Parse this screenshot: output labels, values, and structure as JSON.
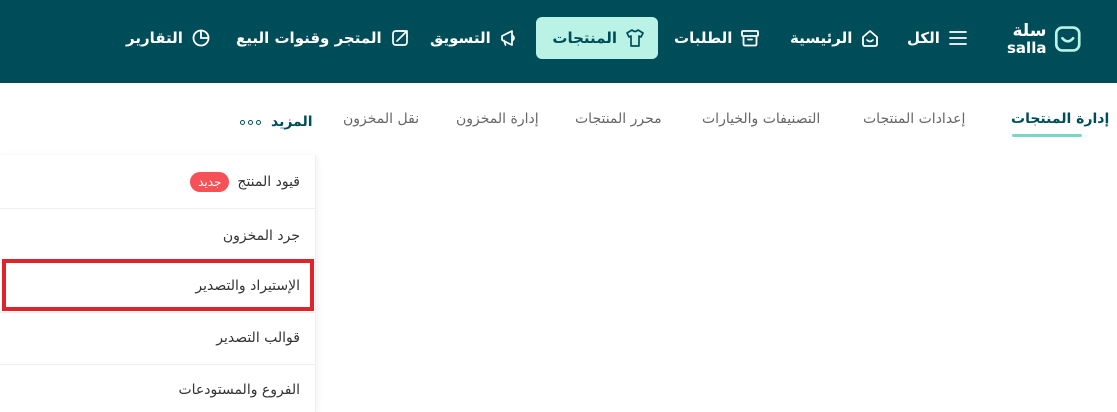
{
  "brand": {
    "name_ar": "سلة",
    "name_en": "salla",
    "colors": {
      "topbar": "#004d5a",
      "active_nav": "#baf3e6",
      "accent": "#7ad7c8",
      "badge": "#f55157",
      "highlight": "#e0242b"
    }
  },
  "nav": {
    "all": {
      "label": "الكل",
      "icon": "menu-icon"
    },
    "home": {
      "label": "الرئيسية",
      "icon": "home-icon"
    },
    "orders": {
      "label": "الطلبات",
      "icon": "archive-box-icon"
    },
    "products": {
      "label": "المنتجات",
      "icon": "tshirt-icon"
    },
    "marketing": {
      "label": "التسويق",
      "icon": "megaphone-icon"
    },
    "store": {
      "label": "المتجر وقنوات البيع",
      "icon": "store-channels-icon"
    },
    "reports": {
      "label": "التقارير",
      "icon": "pie-chart-icon"
    }
  },
  "tabs": {
    "product_management": "إدارة المنتجات",
    "product_settings": "إعدادات المنتجات",
    "categories_options": "التصنيفات والخيارات",
    "product_editor": "محرر المنتجات",
    "inventory_management": "إدارة المخزون",
    "inventory_transfer": "نقل المخزون",
    "more": "المزيد"
  },
  "dropdown": {
    "product_restrictions": {
      "label": "قيود المنتج",
      "badge": "جديد"
    },
    "inventory_count": "جرد المخزون",
    "import_export": "الإستيراد والتصدير",
    "export_templates": "قوالب التصدير",
    "branches_warehouses": "الفروع والمستودعات"
  }
}
